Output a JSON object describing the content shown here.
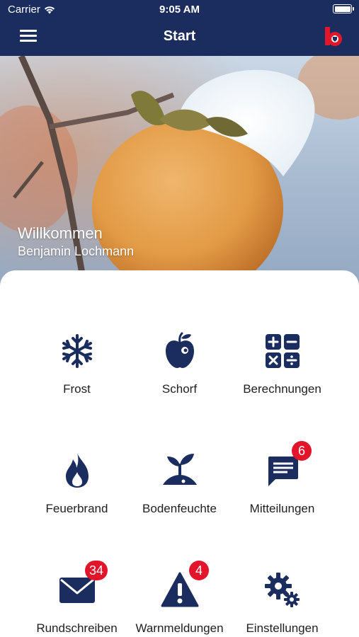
{
  "status_bar": {
    "carrier": "Carrier",
    "time": "9:05 AM"
  },
  "navbar": {
    "title": "Start",
    "menu_icon": "hamburger-menu-icon",
    "logo_icon": "brand-logo"
  },
  "hero": {
    "welcome": "Willkommen",
    "user_name": "Benjamin Lochmann"
  },
  "colors": {
    "primary": "#1b2d5f",
    "badge": "#e3152b"
  },
  "tiles": [
    {
      "label": "Frost",
      "icon": "snowflake-icon"
    },
    {
      "label": "Schorf",
      "icon": "apple-icon"
    },
    {
      "label": "Berechnungen",
      "icon": "calculator-icon"
    },
    {
      "label": "Feuerbrand",
      "icon": "flame-icon"
    },
    {
      "label": "Bodenfeuchte",
      "icon": "seedling-icon"
    },
    {
      "label": "Mitteilungen",
      "icon": "message-icon",
      "badge": "6"
    },
    {
      "label": "Rundschreiben",
      "icon": "envelope-icon",
      "badge": "34"
    },
    {
      "label": "Warnmeldungen",
      "icon": "warning-icon",
      "badge": "4"
    },
    {
      "label": "Einstellungen",
      "icon": "gears-icon"
    }
  ]
}
